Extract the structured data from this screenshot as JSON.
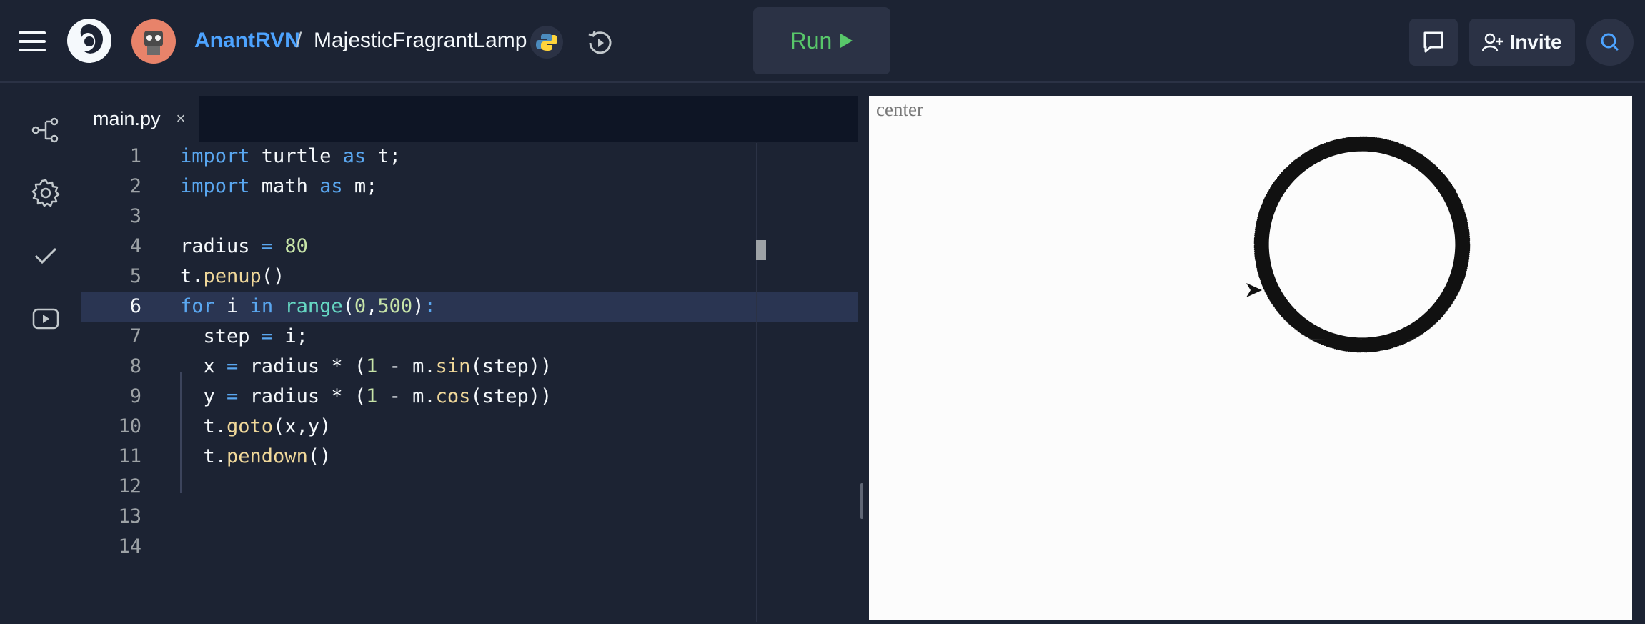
{
  "header": {
    "user": "AnantRVN",
    "separator": "/",
    "repl_name": "MajesticFragrantLamp",
    "run_label": "Run",
    "invite_label": "Invite"
  },
  "editor": {
    "tab_name": "main.py",
    "tab_close": "×",
    "active_line": 6,
    "lines": [
      "import turtle as t;",
      "import math as m;",
      "",
      "radius = 80",
      "t.penup()",
      "for i in range(0,500):",
      "  step = i;",
      "  x = radius * (1 - m.sin(step))",
      "  y = radius * (1 - m.cos(step))",
      "  t.goto(x,y)",
      "  t.pendown()",
      "",
      "",
      ""
    ],
    "line_numbers": [
      "1",
      "2",
      "3",
      "4",
      "5",
      "6",
      "7",
      "8",
      "9",
      "10",
      "11",
      "12",
      "13",
      "14"
    ]
  },
  "output": {
    "canvas_label": "center"
  },
  "colors": {
    "background": "#1c2333",
    "accent_blue": "#4da3ff",
    "run_green": "#58c76a"
  }
}
